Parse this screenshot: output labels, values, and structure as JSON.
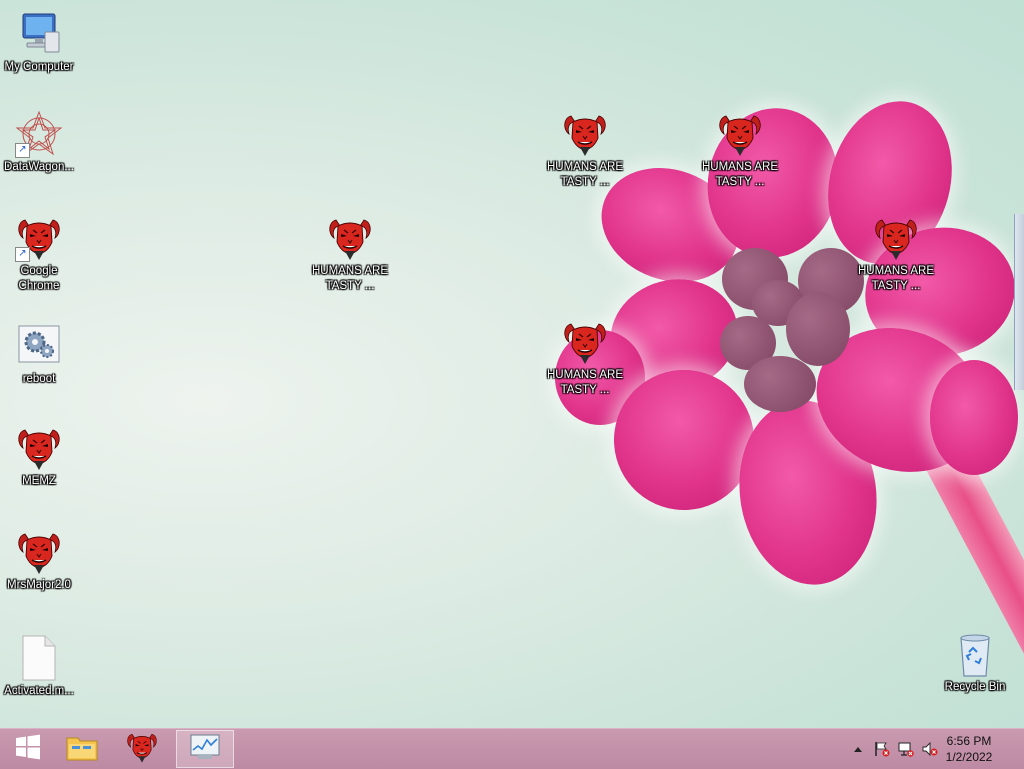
{
  "desktop": {
    "icons": {
      "my_computer": "My Computer",
      "datawagon": "DataWagon...",
      "google_chrome": "Google Chrome",
      "reboot": "reboot",
      "memz": "MEMZ",
      "mrsmajor": "MrsMajor2.0",
      "activated": "Activated.m...",
      "humans_1": "HUMANS ARE TASTY ...",
      "humans_2": "HUMANS ARE TASTY ...",
      "humans_3": "HUMANS ARE TASTY ...",
      "humans_4": "HUMANS ARE TASTY ...",
      "humans_5": "HUMANS ARE TASTY ...",
      "recycle_bin": "Recycle Bin"
    }
  },
  "taskbar": {
    "start_icon": "windows-start-icon",
    "pinned": [
      "file-explorer-icon",
      "demon-app-icon",
      "task-manager-icon"
    ],
    "tray": {
      "show_hidden_icon": "chevron-up-icon",
      "action_center_icon": "flag-icon",
      "network_icon": "network-icon",
      "volume_icon": "volume-muted-icon"
    },
    "clock": {
      "time": "6:56 PM",
      "date": "1/2/2022"
    }
  },
  "colors": {
    "taskbar": "#bd8aa3",
    "petal": "#e0338a",
    "demon_red": "#c0201b"
  }
}
